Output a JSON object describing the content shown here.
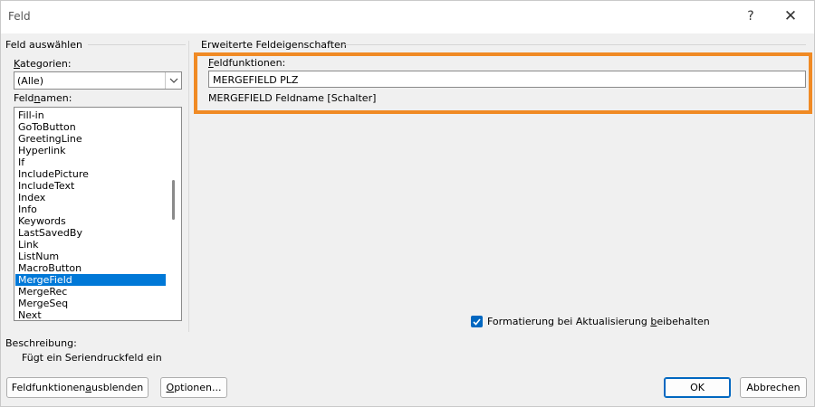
{
  "window": {
    "title": "Feld",
    "help_label": "?",
    "close_label": "✕"
  },
  "left": {
    "group_title": "Feld auswählen",
    "categories": {
      "label_accel": "K",
      "label_rest": "ategorien:",
      "value": "(Alle)"
    },
    "fieldnames": {
      "label_pre": "Feld",
      "label_accel": "n",
      "label_rest": "amen:",
      "items": [
        "Fill-in",
        "GoToButton",
        "GreetingLine",
        "Hyperlink",
        "If",
        "IncludePicture",
        "IncludeText",
        "Index",
        "Info",
        "Keywords",
        "LastSavedBy",
        "Link",
        "ListNum",
        "MacroButton",
        "MergeField",
        "MergeRec",
        "MergeSeq",
        "Next"
      ],
      "selected_index": 14
    }
  },
  "right": {
    "group_title": "Erweiterte Feldeigenschaften",
    "fieldcodes_label_accel": "F",
    "fieldcodes_label_rest": "eldfunktionen:",
    "fieldcode_value": "MERGEFIELD  PLZ",
    "syntax_hint": "MERGEFIELD Feldname [Schalter]",
    "checkbox_pre": "Formatierung bei Aktualisierung ",
    "checkbox_accel": "b",
    "checkbox_rest": "eibehalten",
    "checkbox_checked": true
  },
  "description": {
    "label": "Beschreibung:",
    "text": "Fügt ein Seriendruckfeld ein"
  },
  "buttons": {
    "hide_codes_pre": "Feldfunktionen ",
    "hide_codes_accel": "a",
    "hide_codes_rest": "usblenden",
    "options_accel": "O",
    "options_rest": "ptionen...",
    "ok": "OK",
    "cancel": "Abbrechen"
  },
  "colors": {
    "accent": "#0078d7",
    "highlight": "#f08a24"
  }
}
